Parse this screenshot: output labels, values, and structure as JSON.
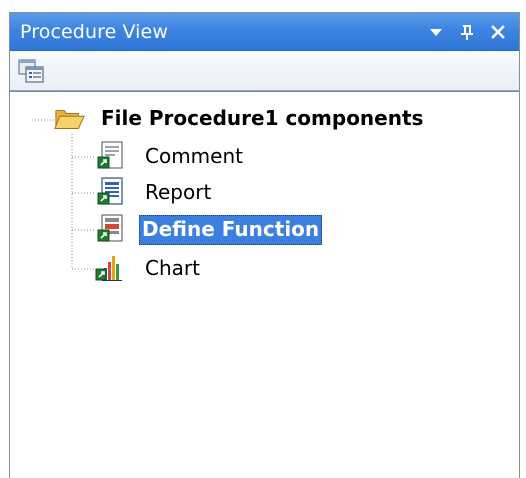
{
  "panel": {
    "title": "Procedure View"
  },
  "toolbar": {
    "items": [
      {
        "icon": "component-list-icon"
      }
    ]
  },
  "tree": {
    "root": {
      "label": "File Procedure1 components",
      "icon": "folder-open-icon"
    },
    "children": [
      {
        "label": "Comment",
        "icon": "comment-component-icon",
        "selected": false
      },
      {
        "label": "Report",
        "icon": "report-component-icon",
        "selected": false
      },
      {
        "label": "Define Function",
        "icon": "define-function-icon",
        "selected": true
      },
      {
        "label": "Chart",
        "icon": "chart-component-icon",
        "selected": false
      }
    ]
  },
  "colors": {
    "title_bar": "#3d84e2",
    "selection": "#3b7fe0"
  }
}
